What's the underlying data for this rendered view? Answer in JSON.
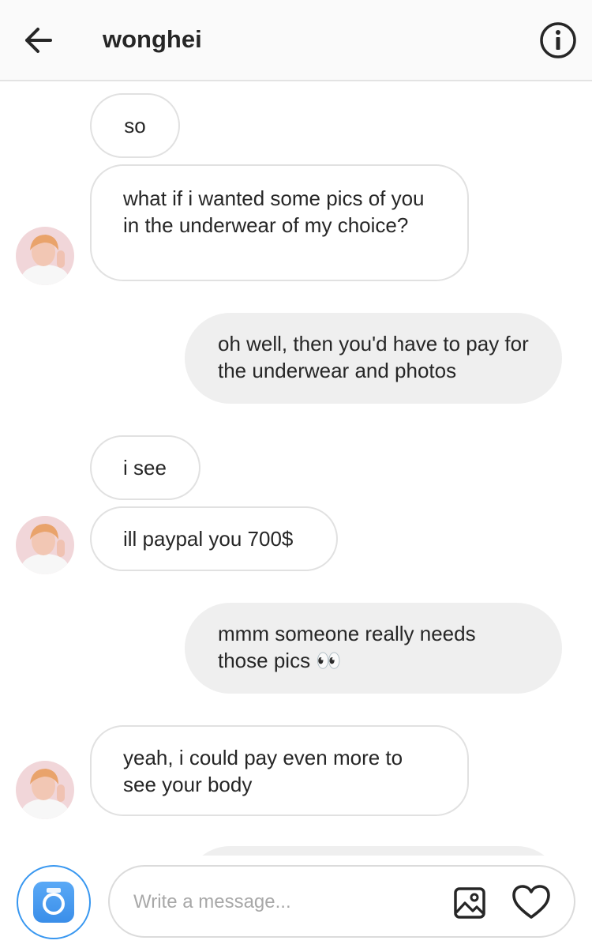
{
  "header": {
    "title": "wonghei",
    "back_icon": "arrow-left-icon",
    "info_icon": "info-circle-icon"
  },
  "messages": [
    {
      "side": "incoming",
      "text": "so"
    },
    {
      "side": "incoming",
      "text": "what if i wanted some pics of you in the underwear of my choice?"
    },
    {
      "side": "outgoing",
      "text": "oh well, then you'd have to pay for the underwear and photos"
    },
    {
      "side": "incoming",
      "text": "i see"
    },
    {
      "side": "incoming",
      "text": "ill paypal you 700$"
    },
    {
      "side": "outgoing",
      "text": "mmm someone really needs those pics 👀"
    },
    {
      "side": "incoming",
      "text": "yeah, i could pay even more to see your body"
    }
  ],
  "composer": {
    "placeholder": "Write a message...",
    "camera_icon": "camera-icon",
    "gallery_icon": "image-icon",
    "like_icon": "heart-icon"
  },
  "colors": {
    "accent": "#3897f0",
    "outgoing_bubble": "#efefef",
    "incoming_border": "#e1e1e1",
    "text": "#262626"
  }
}
